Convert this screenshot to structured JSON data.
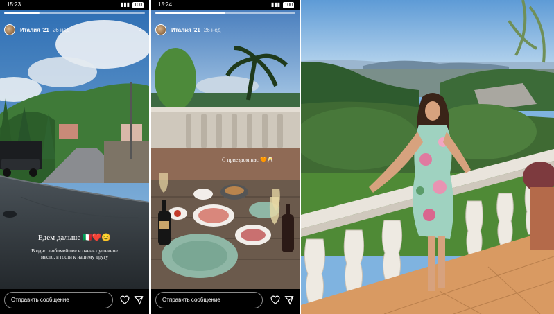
{
  "stories": [
    {
      "status_time": "15:23",
      "battery": "100",
      "username": "Италия '21",
      "ago": "26 нед",
      "caption_title": "Едем дальше",
      "caption_emoji": "🇮🇹❤️😊",
      "caption_line1": "В одно любимейшее и очень душевное",
      "caption_line2": "место, в гости к нашему другу",
      "reply_placeholder": "Отправить сообщение",
      "progress": 0.25,
      "icons": [
        "heart-icon",
        "send-icon",
        "more-icon"
      ]
    },
    {
      "status_time": "15:24",
      "battery": "100",
      "username": "Италия '21",
      "ago": "26 нед",
      "sticker_text": "С приездом нас",
      "sticker_emoji": "🧡🥂",
      "reply_placeholder": "Отправить сообщение",
      "progress": 0.5,
      "icons": [
        "heart-icon",
        "send-icon",
        "more-icon"
      ]
    }
  ],
  "colors": {
    "ui_background": "#000000",
    "ui_text": "#ffffff",
    "reply_border": "#8a8a8a"
  }
}
